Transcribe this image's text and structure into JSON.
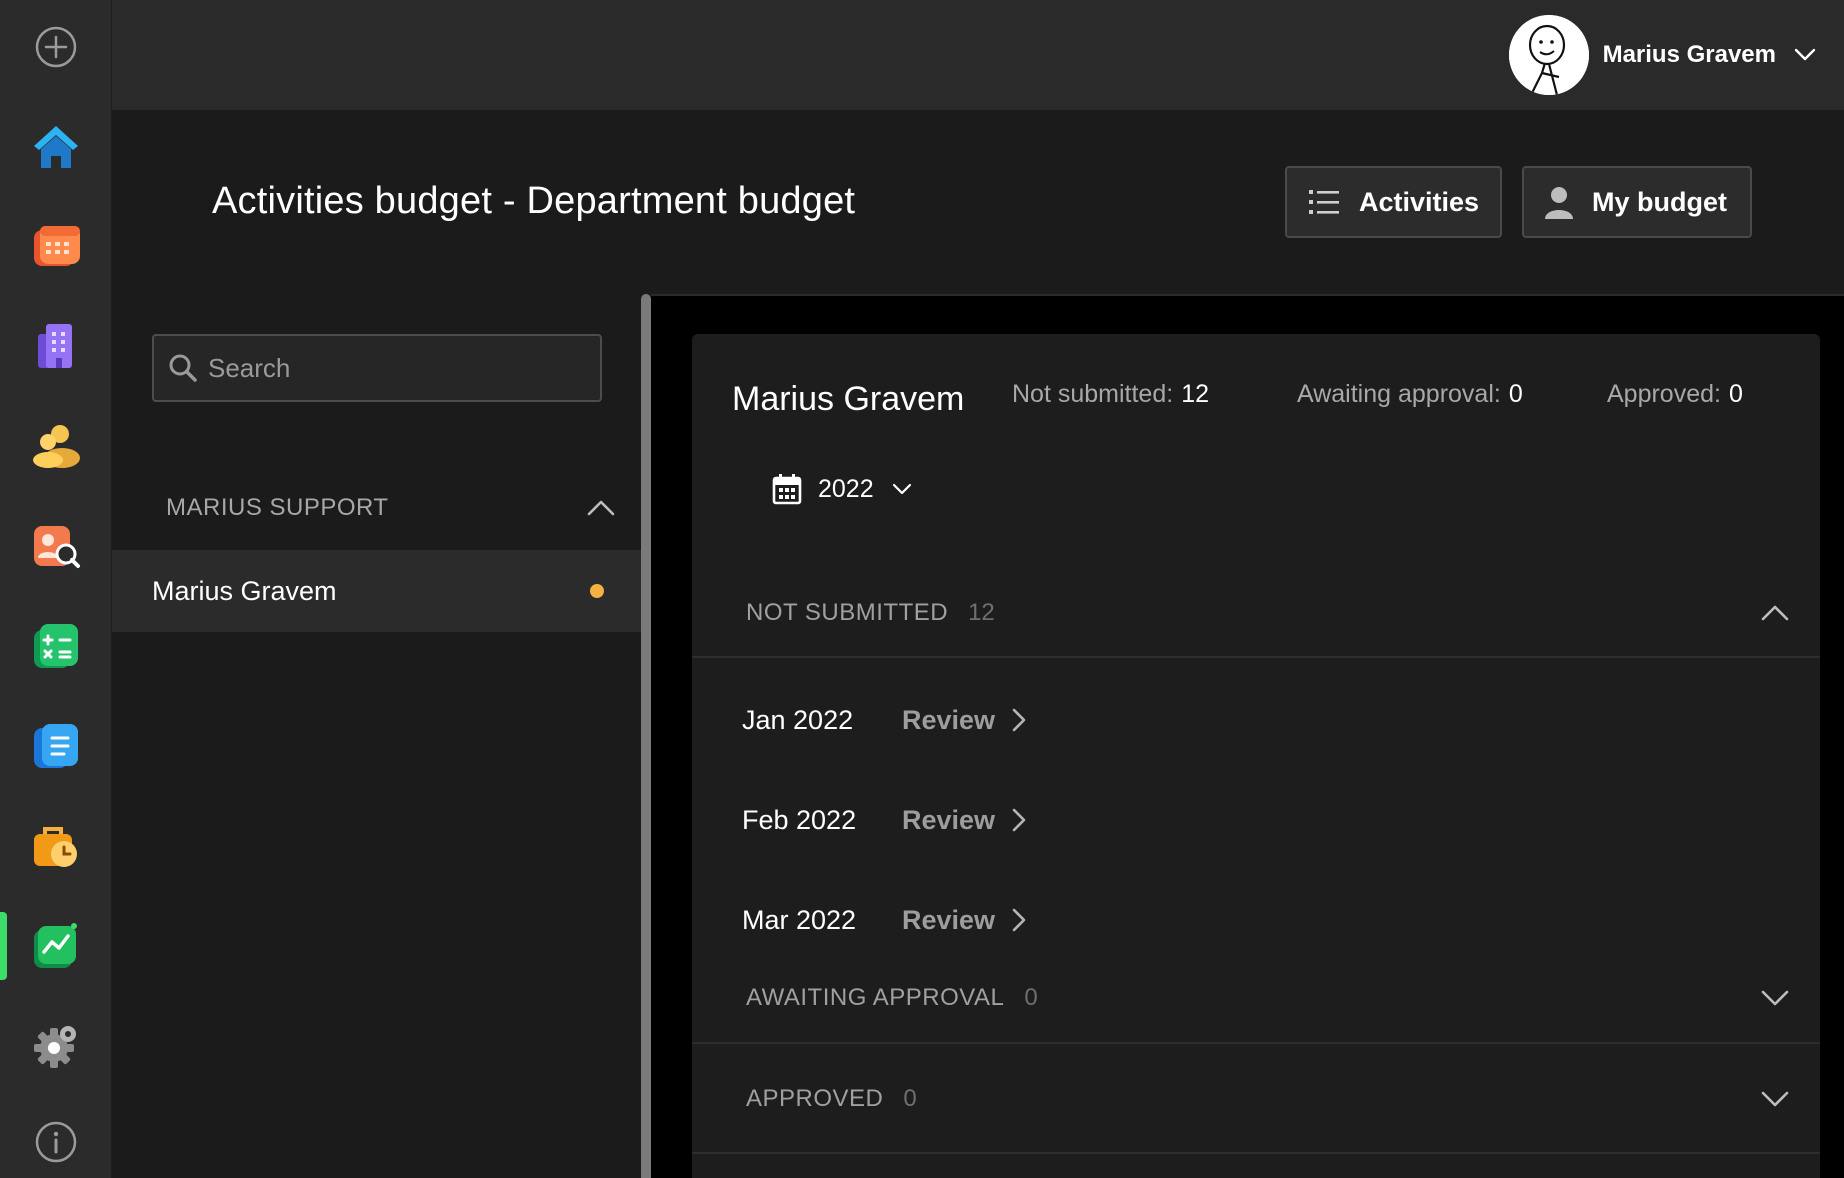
{
  "rail": {
    "items": [
      "add-icon",
      "home-icon",
      "calendar-icon",
      "building-icon",
      "people-icon",
      "person-search-icon",
      "calculator-icon",
      "document-icon",
      "briefcase-clock-icon",
      "chart-icon",
      "settings-icon",
      "info-icon"
    ],
    "active": "chart-icon",
    "active_color": "#3ddc6a"
  },
  "topbar": {
    "user_name": "Marius Gravem"
  },
  "header": {
    "title": "Activities budget - Department budget",
    "activities_label": "Activities",
    "my_budget_label": "My budget"
  },
  "left_panel": {
    "search_placeholder": "Search",
    "group_label": "MARIUS SUPPORT",
    "members": [
      {
        "name": "Marius Gravem",
        "status_color": "#f4b142"
      }
    ]
  },
  "card": {
    "name": "Marius Gravem",
    "stats": {
      "not_submitted_label": "Not submitted:",
      "not_submitted_value": "12",
      "awaiting_label": "Awaiting approval:",
      "awaiting_value": "0",
      "approved_label": "Approved:",
      "approved_value": "0"
    },
    "year": "2022",
    "sections": {
      "not_submitted": {
        "title": "NOT SUBMITTED",
        "count": "12"
      },
      "awaiting": {
        "title": "AWAITING APPROVAL",
        "count": "0"
      },
      "approved": {
        "title": "APPROVED",
        "count": "0"
      }
    },
    "months": [
      {
        "label": "Jan 2022",
        "action": "Review"
      },
      {
        "label": "Feb 2022",
        "action": "Review"
      },
      {
        "label": "Mar 2022",
        "action": "Review"
      }
    ]
  }
}
